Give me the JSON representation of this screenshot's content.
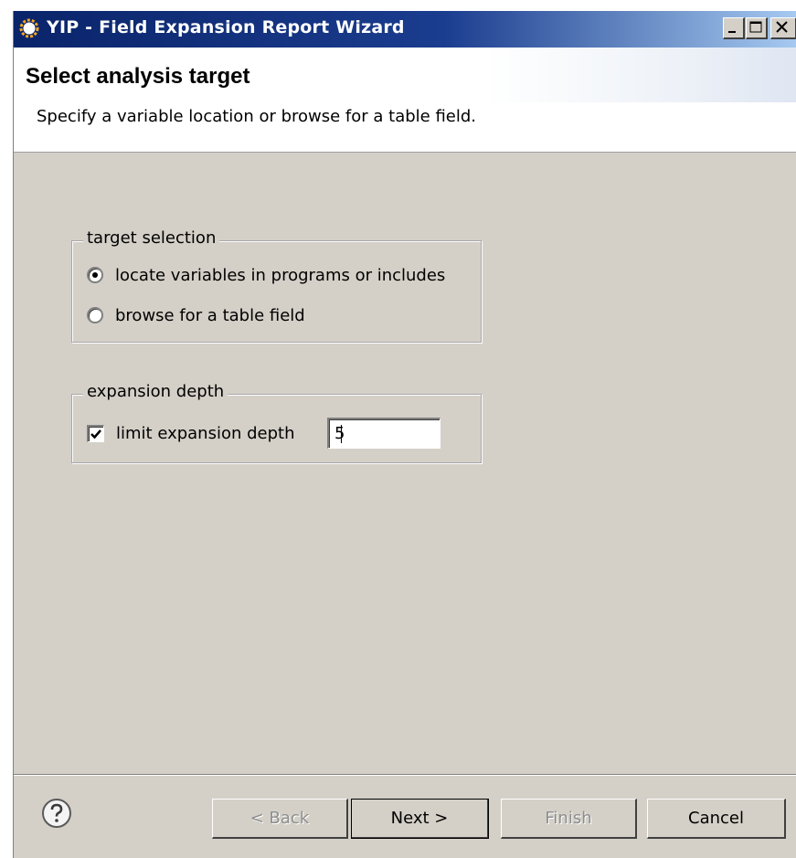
{
  "window": {
    "title": "YIP  -  Field Expansion Report Wizard",
    "controls": [
      "minimize-icon",
      "maximize-icon",
      "close-icon"
    ]
  },
  "header": {
    "title": "Select analysis target",
    "description": "Specify a variable location or browse for a table field."
  },
  "target_selection": {
    "legend": "target selection",
    "options": [
      {
        "label": "locate variables in programs or includes",
        "checked": true
      },
      {
        "label": "browse for a table field",
        "checked": false
      }
    ]
  },
  "expansion_depth": {
    "legend": "expansion depth",
    "limit_label": "limit expansion depth",
    "limit_checked": true,
    "depth_value": "5"
  },
  "footer": {
    "help_icon": "help-icon",
    "back_label": "< Back",
    "next_label": "Next >",
    "finish_label": "Finish",
    "cancel_label": "Cancel"
  },
  "colors": {
    "titlebar_start": "#0a246a",
    "dialog_background": "#d4d0c8",
    "disabled_text": "#8d8d8d"
  }
}
